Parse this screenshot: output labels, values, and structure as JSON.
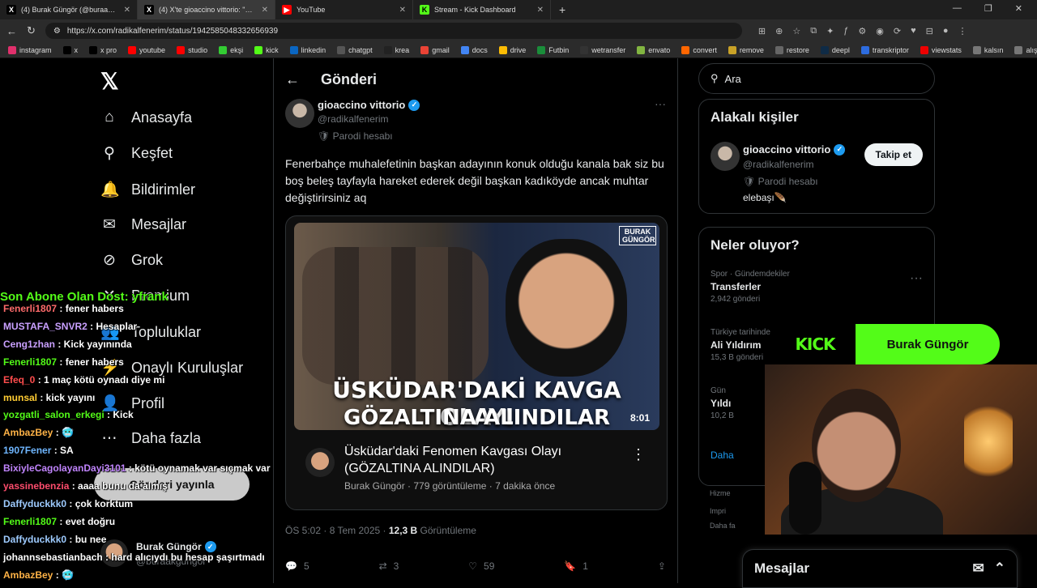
{
  "browser": {
    "tabs": [
      {
        "title": "(4) Burak Güngör (@buraakgung",
        "icon": "X",
        "color": "#000000"
      },
      {
        "title": "(4) X'te gioaccino vittorio: \"Fenerb",
        "icon": "X",
        "color": "#000000"
      },
      {
        "title": "YouTube",
        "icon": "▶",
        "color": "#ff0000"
      },
      {
        "title": "Stream - Kick Dashboard",
        "icon": "K",
        "color": "#53fc18"
      }
    ],
    "url": "https://x.com/radikalfenerim/status/1942585048332656939",
    "bookmarks": [
      "instagram",
      "x",
      "x pro",
      "youtube",
      "studio",
      "ekşi",
      "kick",
      "linkedin",
      "chatgpt",
      "krea",
      "gmail",
      "docs",
      "drive",
      "Futbin",
      "wetransfer",
      "envato",
      "convert",
      "remove",
      "restore",
      "deepl",
      "transkriptor",
      "viewstats",
      "kalsın",
      "alışveriş"
    ]
  },
  "sidebar": {
    "items": [
      {
        "label": "Anasayfa",
        "icon": "home-icon",
        "glyph": "⌂"
      },
      {
        "label": "Keşfet",
        "icon": "search-icon",
        "glyph": "⚲"
      },
      {
        "label": "Bildirimler",
        "icon": "bell-icon",
        "glyph": "🔔"
      },
      {
        "label": "Mesajlar",
        "icon": "mail-icon",
        "glyph": "✉"
      },
      {
        "label": "Grok",
        "icon": "grok-icon",
        "glyph": "⊘"
      },
      {
        "label": "Premium",
        "icon": "x-icon",
        "glyph": "✕"
      },
      {
        "label": "Topluluklar",
        "icon": "people-icon",
        "glyph": "👥"
      },
      {
        "label": "Onaylı Kuruluşlar",
        "icon": "lightning-icon",
        "glyph": "⚡"
      },
      {
        "label": "Profil",
        "icon": "profile-icon",
        "glyph": "👤"
      },
      {
        "label": "Daha fazla",
        "icon": "more-icon",
        "glyph": "⋯"
      }
    ],
    "post_button": "Gönderi yayınla",
    "account": {
      "name": "Burak Güngör",
      "handle": "@buraakgungor"
    }
  },
  "post": {
    "header": "Gönderi",
    "author": "gioaccino vittorio",
    "handle": "@radikalfenerim",
    "badge": "Parodi hesabı",
    "text": "Fenerbahçe muhalefetinin başkan adayının konuk olduğu kanala bak siz bu boş beleş tayfayla hareket ederek değil başkan kadıköyde ancak muhtar değiştirirsiniz aq",
    "video": {
      "caption_line1": "ÜSKÜDAR'DAKİ KAVGA OLAYI",
      "caption_line2": "GÖZALTINA ALINDILAR",
      "brand": "BURAK GÜNGÖR",
      "duration": "8:01",
      "title": "Üsküdar'daki Fenomen Kavgası Olayı (GÖZALTINA ALINDILAR)",
      "meta": "Burak Güngör · 779 görüntüleme · 7 dakika önce"
    },
    "time": "ÖS 5:02 · 8 Tem 2025 · ",
    "views": "12,3 B",
    "views_label": " Görüntüleme",
    "replies": "5",
    "reposts": "3",
    "likes": "59",
    "bookmarks": "1"
  },
  "right": {
    "search_placeholder": "Ara",
    "related_title": "Alakalı kişiler",
    "related": {
      "name": "gioaccino vittorio",
      "handle": "@radikalfenerim",
      "badge": "Parodi hesabı",
      "bio": "elebaşı🪶",
      "follow": "Takip et"
    },
    "trends_title": "Neler oluyor?",
    "trends": [
      {
        "category": "Spor · Gündemdekiler",
        "name": "Transferler",
        "count": "2,942 gönderi"
      },
      {
        "category": "Türkiye tarihinde",
        "name": "Ali Yıldırım",
        "count": "15,3 B gönderi"
      },
      {
        "category": "Gün",
        "name": "Yıldı",
        "count": "10,2 B"
      }
    ],
    "show_more": "Daha",
    "footer": [
      "Hizme",
      "Impri",
      "Daha fa"
    ],
    "messages": "Mesajlar"
  },
  "overlay": {
    "sub_banner": "Son Abone Olan Dost: yfrank",
    "chat": [
      {
        "user": "Fenerli1807",
        "msg": " : fener habers",
        "color": "#ff6b6b"
      },
      {
        "user": "MUSTAFA_SNVR2",
        "msg": " : Hesaplar",
        "color": "#c9a0ff"
      },
      {
        "user": "Ceng1zhan",
        "msg": " : Kick yayınında",
        "color": "#c9a0ff"
      },
      {
        "user": "Fenerli1807",
        "msg": " : fener habers",
        "color": "#53fc18"
      },
      {
        "user": "Efeq_0",
        "msg": " : 1 maç kötü oynadı diye mi",
        "color": "#ff4d4d"
      },
      {
        "user": "munsal",
        "msg": " : kick yayını",
        "color": "#ffcc33"
      },
      {
        "user": "yozgatli_salon_erkegi",
        "msg": " : Kick",
        "color": "#53fc18"
      },
      {
        "user": "AmbazBey",
        "msg": " : 🥶",
        "color": "#ffb347"
      },
      {
        "user": "1907Fener",
        "msg": " : SA",
        "color": "#6fb6ff"
      },
      {
        "user": "BixiyleCagolayanDayi3101",
        "msg": " : kötü oynamak var sıçmak var",
        "color": "#c084fc"
      },
      {
        "user": "yassinebenzia",
        "msg": " : aaaa bunu da almış",
        "color": "#ff4d6d"
      },
      {
        "user": "Daffyduckkk0",
        "msg": " : çok korktum",
        "color": "#9ecbff"
      },
      {
        "user": "Fenerli1807",
        "msg": " : evet doğru",
        "color": "#53fc18"
      },
      {
        "user": "Daffyduckkk0",
        "msg": " : bu nee",
        "color": "#9ecbff"
      },
      {
        "user": "johannsebastianbach",
        "msg": " : hard alıcıydı bu hesap şaşırtmadı",
        "color": "#ffffff"
      },
      {
        "user": "AmbazBey",
        "msg": " : 🥶",
        "color": "#ffb347"
      }
    ],
    "kick_logo": "KICK",
    "streamer": "Burak Güngör"
  }
}
